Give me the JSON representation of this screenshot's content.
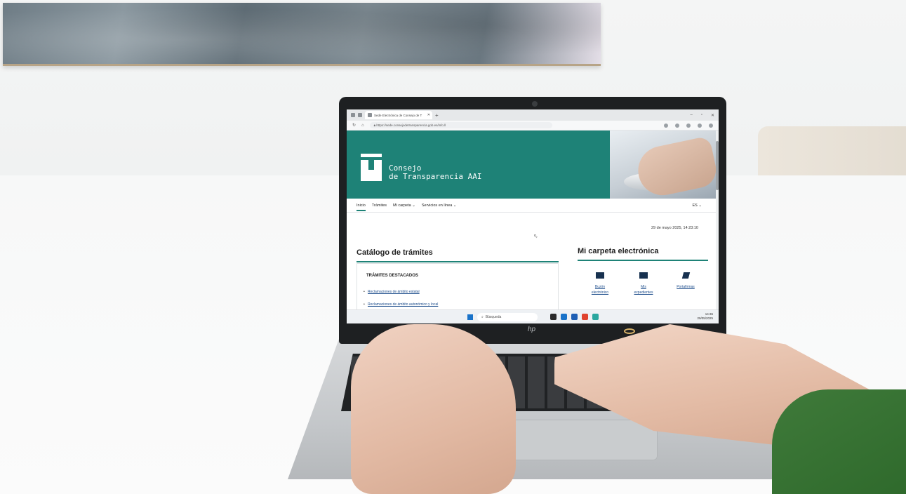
{
  "browser": {
    "tab_title": "Sede Electrónica de Consejo de T",
    "url": "https://sede.consejodetransparencia.gob.es/info.ll"
  },
  "site": {
    "brand_line1": "Consejo",
    "brand_line2": "de Transparencia AAI",
    "nav": [
      "Inicio",
      "Trámites",
      "Mi carpeta ⌄",
      "Servicios en línea ⌄"
    ],
    "language": "ES ⌄",
    "datetime": "29 de mayo 2025, 14:23:10",
    "catalog": {
      "title": "Catálogo de trámites",
      "featured_title": "TRÁMITES DESTACADOS",
      "links": [
        "Reclamaciones de ámbito estatal",
        "Reclamaciones de ámbito autonómico y local"
      ]
    },
    "folder": {
      "title": "Mi carpeta electrónica",
      "items": [
        {
          "label1": "Buzón",
          "label2": "electrónico",
          "icon": "envelope-icon"
        },
        {
          "label1": "Mis",
          "label2": "expedientes",
          "icon": "folder-icon"
        },
        {
          "label1": "Portafirmas",
          "label2": "",
          "icon": "pen-icon"
        }
      ]
    }
  },
  "taskbar": {
    "search_placeholder": "Búsqueda",
    "time": "14:36",
    "date": "29/05/2025"
  },
  "laptop": {
    "logo": "hp"
  }
}
